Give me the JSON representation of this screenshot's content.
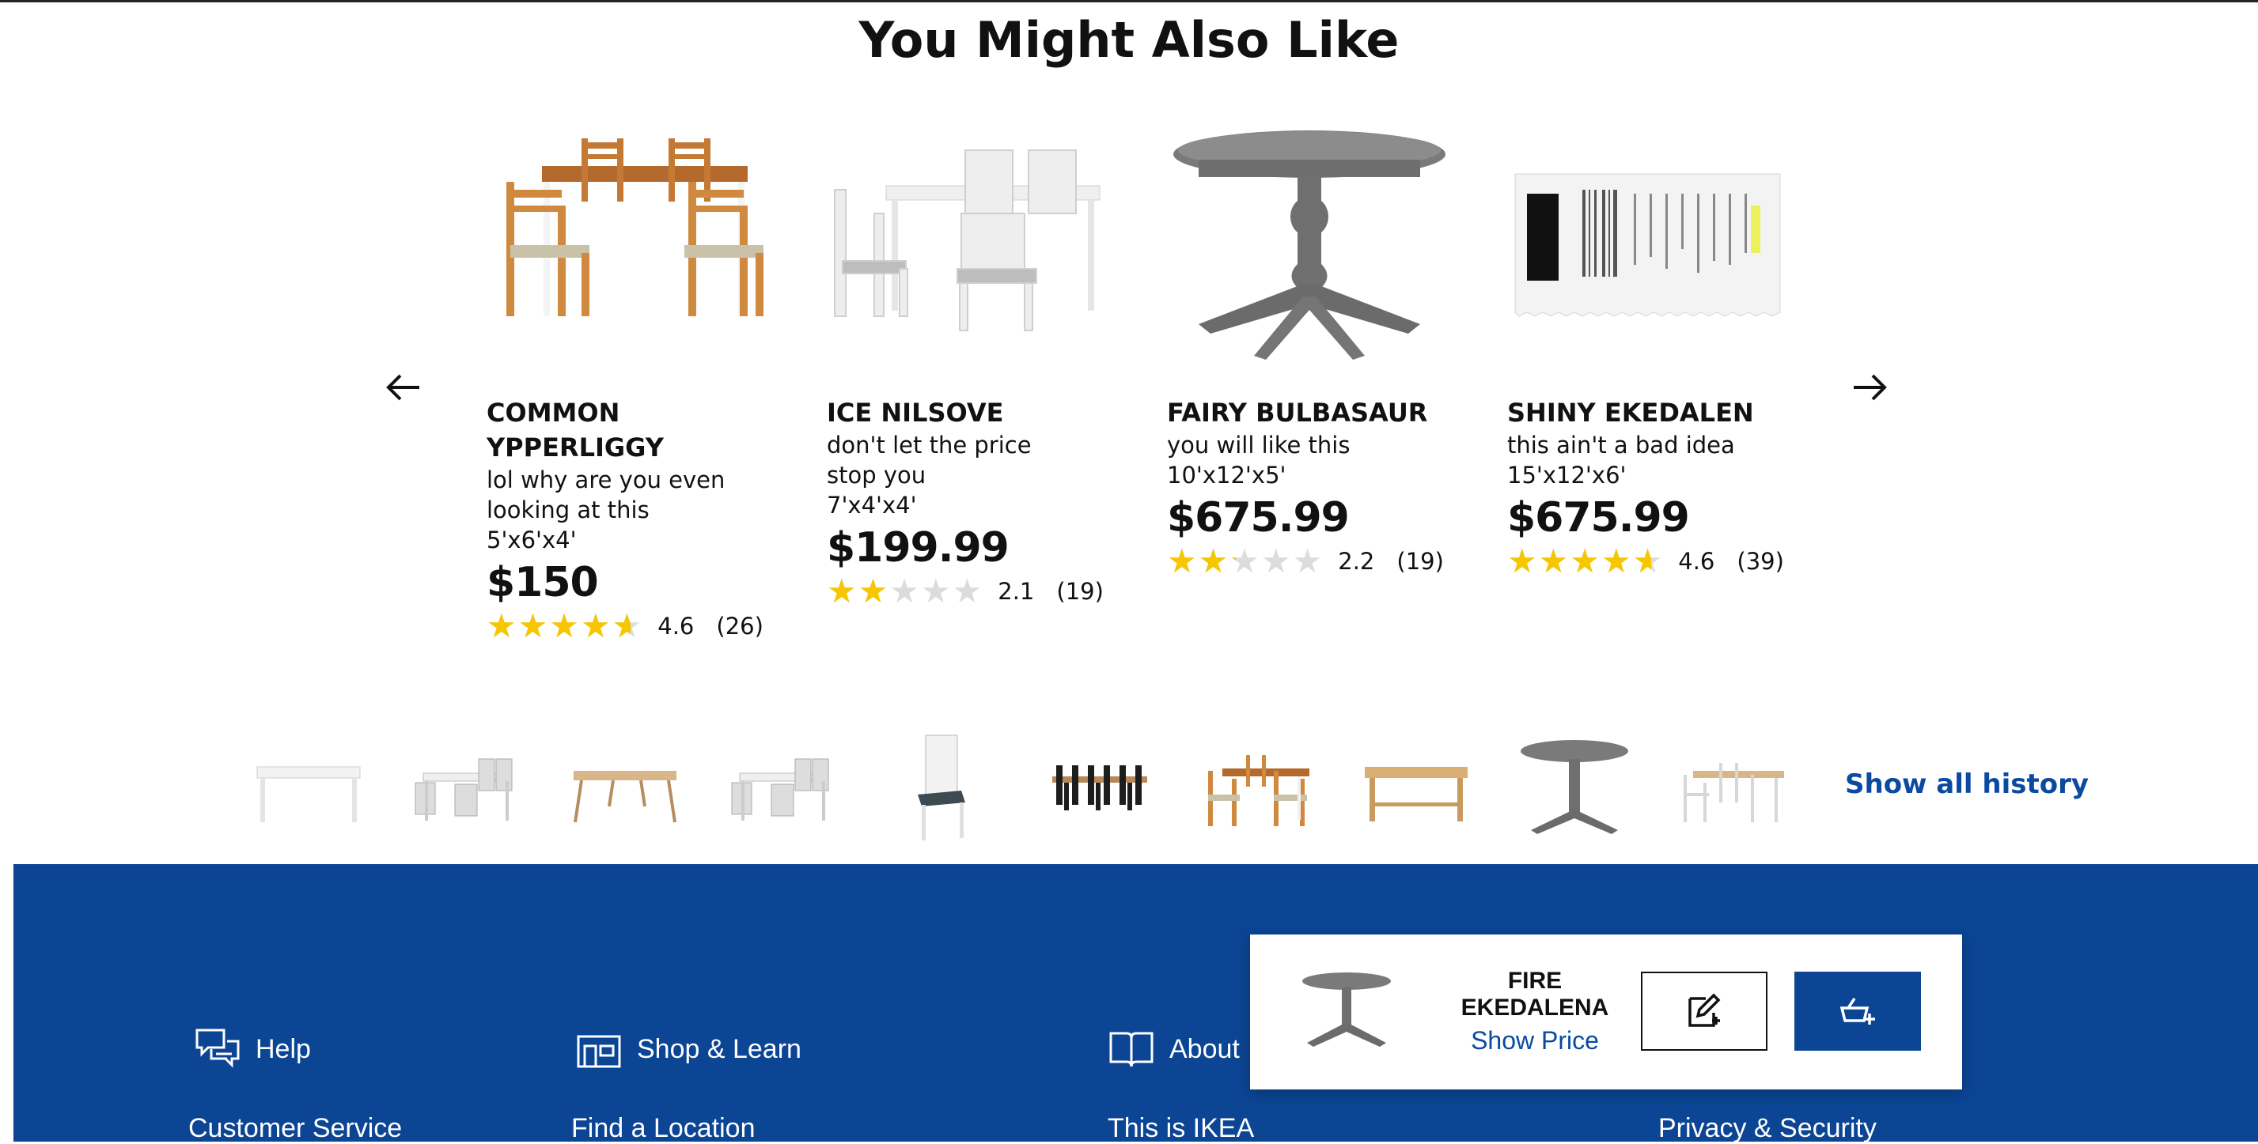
{
  "section": {
    "title": "You Might Also Like"
  },
  "carousel": {
    "items": [
      {
        "name": "COMMON YPPERLIGGY",
        "desc": "lol why are you even looking at this",
        "dims": "5'x6'x4'",
        "price": "$150",
        "rating": 4.6,
        "rating_text": "4.6",
        "reviews": "(26)",
        "image": "wooden-dining-set"
      },
      {
        "name": "ICE NILSOVE",
        "desc": "don't let the price stop you",
        "dims": "7'x4'x4'",
        "price": "$199.99",
        "rating": 2.1,
        "rating_text": "2.1",
        "reviews": "(19)",
        "image": "white-dining-set"
      },
      {
        "name": "FAIRY BULBASAUR",
        "desc": "you will like this",
        "dims": "10'x12'x5'",
        "price": "$675.99",
        "rating": 2.2,
        "rating_text": "2.2",
        "reviews": "(19)",
        "image": "grey-round-table"
      },
      {
        "name": "SHINY EKEDALEN",
        "desc": "this ain't a bad idea",
        "dims": "15'x12'x6'",
        "price": "$675.99",
        "rating": 4.6,
        "rating_text": "4.6",
        "reviews": "(39)",
        "image": "receipt"
      }
    ]
  },
  "history": {
    "thumbs": [
      "white-table",
      "white-dining-set",
      "light-wood-table",
      "white-dining-set",
      "white-chair",
      "black-dining-set",
      "wooden-dining-set",
      "pine-table",
      "grey-round-table",
      "white-wood-dining-set"
    ],
    "show_all_label": "Show all history"
  },
  "footer": {
    "columns": [
      {
        "heading": "Help",
        "icon": "chat-icon",
        "link": "Customer Service"
      },
      {
        "heading": "Shop & Learn",
        "icon": "store-icon",
        "link": "Find a Location"
      },
      {
        "heading": "About",
        "icon": "book-icon",
        "link": "This is IKEA"
      },
      {
        "heading": "",
        "icon": "",
        "link": "Privacy & Security"
      }
    ],
    "bg_color": "#0b4594"
  },
  "sticky": {
    "name": "FIRE EKEDALENA",
    "price_label": "Show Price",
    "image": "grey-round-table"
  },
  "colors": {
    "accent": "#0b4594",
    "link": "#0a4aa0",
    "star": "#f6c700"
  }
}
